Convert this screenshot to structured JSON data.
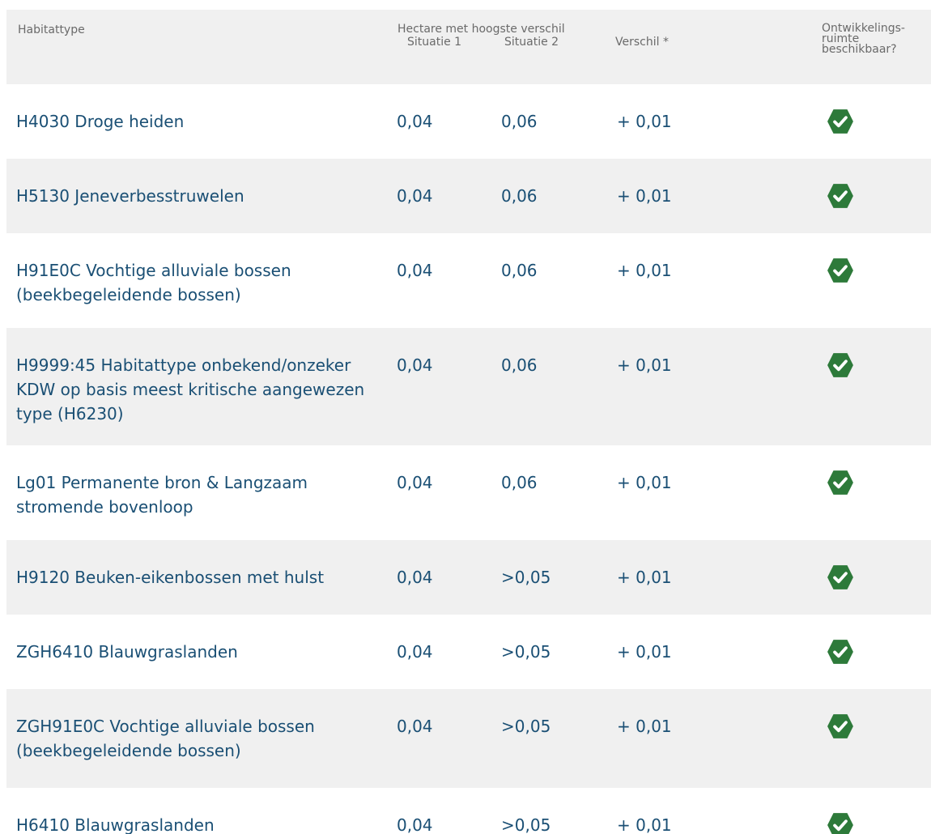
{
  "header": {
    "habitattype": "Habitattype",
    "group": "Hectare met hoogste verschil",
    "situatie1": "Situatie 1",
    "situatie2": "Situatie 2",
    "verschil": "Verschil *",
    "ontwikkelingsruimte": "Ontwikkelings-\nruimte\nbeschikbaar?"
  },
  "colors": {
    "header_bg": "#f0f0f0",
    "row_alt_bg": "#f0f0f0",
    "text_primary": "#1a4f74",
    "text_header": "#6a6a6a",
    "check_green": "#2d7a3a"
  },
  "rows": [
    {
      "name": "H4030 Droge heiden",
      "situatie1": "0,04",
      "situatie2": "0,06",
      "verschil": "+ 0,01",
      "available_icon": "check-icon"
    },
    {
      "name": "H5130 Jeneverbesstruwelen",
      "situatie1": "0,04",
      "situatie2": "0,06",
      "verschil": "+ 0,01",
      "available_icon": "check-icon"
    },
    {
      "name": "H91E0C Vochtige alluviale bossen (beekbegeleidende bossen)",
      "situatie1": "0,04",
      "situatie2": "0,06",
      "verschil": "+ 0,01",
      "available_icon": "check-icon"
    },
    {
      "name": "H9999:45 Habitattype onbekend/onzeker KDW op basis meest kritische aangewezen type (H6230)",
      "situatie1": "0,04",
      "situatie2": "0,06",
      "verschil": "+ 0,01",
      "available_icon": "check-icon"
    },
    {
      "name": "Lg01 Permanente bron & Langzaam stromende bovenloop",
      "situatie1": "0,04",
      "situatie2": "0,06",
      "verschil": "+ 0,01",
      "available_icon": "check-icon"
    },
    {
      "name": "H9120 Beuken-eikenbossen met hulst",
      "situatie1": "0,04",
      "situatie2": ">0,05",
      "verschil": "+ 0,01",
      "available_icon": "check-icon"
    },
    {
      "name": "ZGH6410 Blauwgraslanden",
      "situatie1": "0,04",
      "situatie2": ">0,05",
      "verschil": "+ 0,01",
      "available_icon": "check-icon"
    },
    {
      "name": "ZGH91E0C Vochtige alluviale bossen (beekbegeleidende bossen)",
      "situatie1": "0,04",
      "situatie2": ">0,05",
      "verschil": "+ 0,01",
      "available_icon": "check-icon"
    },
    {
      "name": "H6410 Blauwgraslanden",
      "situatie1": "0,04",
      "situatie2": ">0,05",
      "verschil": "+ 0,01",
      "available_icon": "check-icon"
    }
  ]
}
